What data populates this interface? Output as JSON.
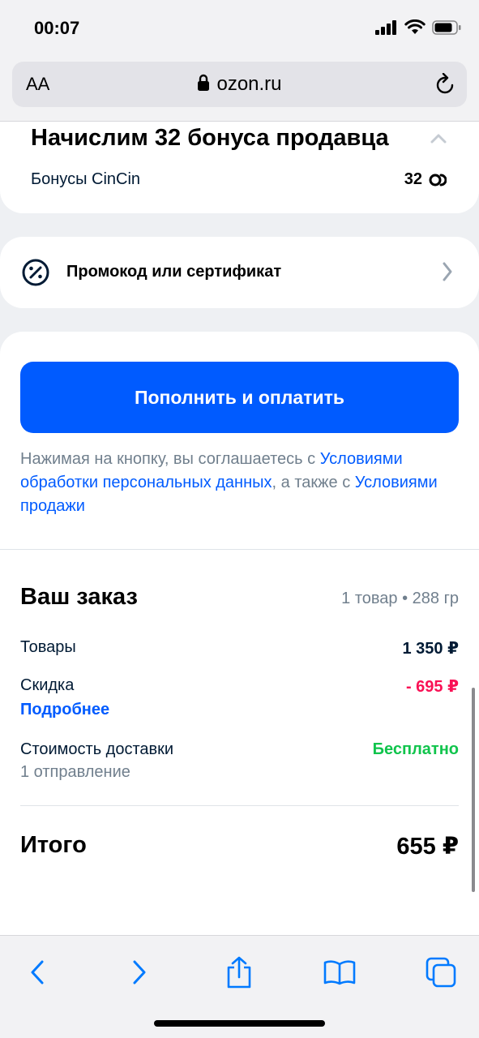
{
  "status_bar": {
    "time": "00:07"
  },
  "browser": {
    "text_size_label": "AA",
    "url": "ozon.ru"
  },
  "bonus": {
    "title": "Начислим 32 бонуса продавца",
    "label": "Бонусы CinCin",
    "value": "32"
  },
  "promo": {
    "label": "Промокод или сертификат"
  },
  "checkout": {
    "pay_button": "Пополнить и оплатить",
    "terms_prefix": "Нажимая на кнопку, вы соглашаетесь с ",
    "terms_link1": "Условиями обработки персональных данных",
    "terms_middle": ", а также с ",
    "terms_link2": "Условиями продажи"
  },
  "order": {
    "title": "Ваш заказ",
    "meta": "1 товар • 288 гр",
    "goods_label": "Товары",
    "goods_value": "1 350 ₽",
    "discount_label": "Скидка",
    "discount_value": "- 695 ₽",
    "details_link": "Подробнее",
    "delivery_label": "Стоимость доставки",
    "delivery_value": "Бесплатно",
    "shipments": "1 отправление",
    "total_label": "Итого",
    "total_value": "655 ₽"
  },
  "colors": {
    "accent": "#005bff",
    "discount": "#f91155",
    "free": "#10c44c",
    "muted": "#707f8d"
  }
}
